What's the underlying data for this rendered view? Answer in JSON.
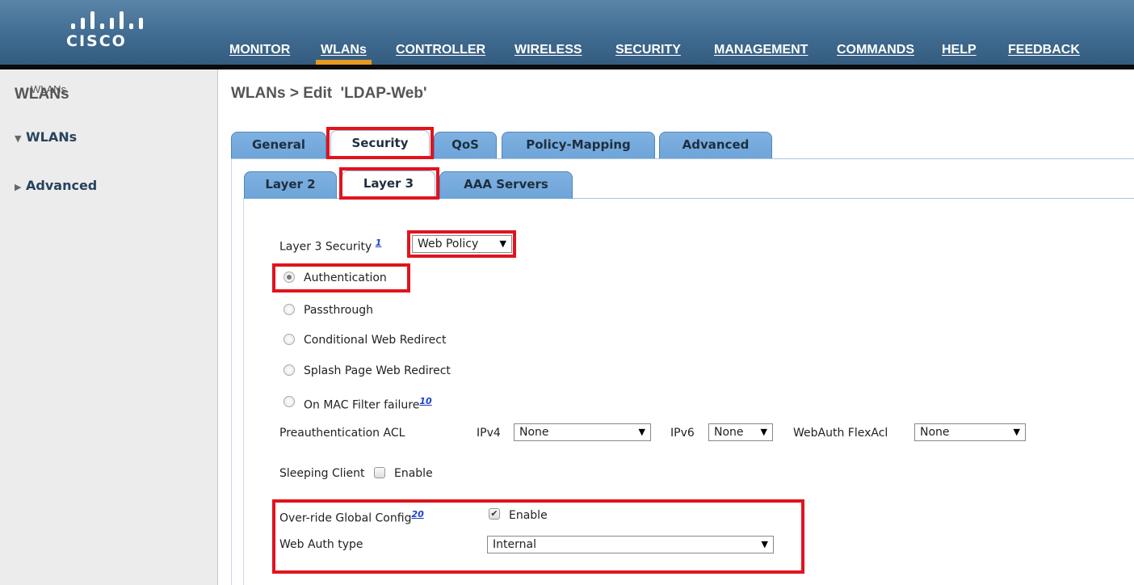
{
  "header": {
    "logo_text": "CISCO",
    "nav": [
      {
        "label": "MONITOR"
      },
      {
        "label": "WLANs",
        "active": true
      },
      {
        "label": "CONTROLLER"
      },
      {
        "label": "WIRELESS"
      },
      {
        "label": "SECURITY"
      },
      {
        "label": "MANAGEMENT"
      },
      {
        "label": "COMMANDS"
      },
      {
        "label": "HELP"
      },
      {
        "label": "FEEDBACK"
      }
    ]
  },
  "sidebar": {
    "title": "WLANs",
    "items": [
      {
        "label": "WLANs",
        "expanded": true,
        "children": [
          "WLANs"
        ]
      },
      {
        "label": "Advanced",
        "expanded": false
      }
    ]
  },
  "page": {
    "title": "WLANs > Edit  'LDAP-Web'",
    "tabs": [
      "General",
      "Security",
      "QoS",
      "Policy-Mapping",
      "Advanced"
    ],
    "active_tab": "Security",
    "subtabs": [
      "Layer 2",
      "Layer 3",
      "AAA Servers"
    ],
    "active_subtab": "Layer 3"
  },
  "form": {
    "layer3_label": "Layer 3 Security",
    "layer3_sup": "1",
    "layer3_value": "Web Policy",
    "radios": [
      {
        "label": "Authentication",
        "checked": true
      },
      {
        "label": "Passthrough",
        "checked": false
      },
      {
        "label": "Conditional Web Redirect",
        "checked": false
      },
      {
        "label": "Splash Page Web Redirect",
        "checked": false
      },
      {
        "label": "On MAC Filter failure",
        "sup": "10",
        "checked": false
      }
    ],
    "preauth": {
      "label": "Preauthentication ACL",
      "ipv4_label": "IPv4",
      "ipv4_value": "None",
      "ipv6_label": "IPv6",
      "ipv6_value": "None",
      "flex_label": "WebAuth FlexAcl",
      "flex_value": "None"
    },
    "sleeping_client": {
      "label": "Sleeping Client",
      "checkbox_label": "Enable",
      "checked": false
    },
    "override": {
      "label": "Over-ride Global Config",
      "sup": "20",
      "checkbox_label": "Enable",
      "checked": true
    },
    "webauth_type": {
      "label": "Web Auth type",
      "value": "Internal"
    }
  },
  "icons": {
    "dropdown_arrow": "▼",
    "expanded_triangle": "▼",
    "collapsed_triangle": "▶",
    "checkmark": "✔"
  },
  "colors": {
    "header_blue": "#3f6a8f",
    "active_nav_underline": "#e59a21",
    "tab_blue": "#6ea4d9",
    "highlight_red": "#e0141e"
  }
}
